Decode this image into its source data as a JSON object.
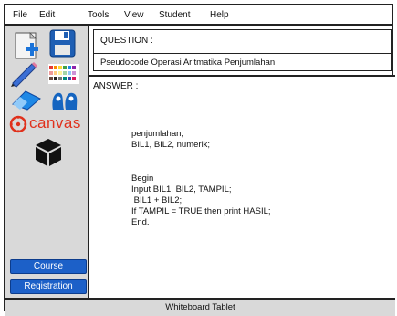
{
  "menu": {
    "items": [
      "File",
      "Edit",
      "Tools",
      "View",
      "Student",
      "Help"
    ]
  },
  "sidebar": {
    "tools": [
      "new-document-icon",
      "save-icon",
      "pencil-icon",
      "color-palette-icon",
      "eraser-icon",
      "blob-icon",
      "canvas-logo",
      "cube-icon"
    ],
    "canvas_logo_text": "canvas",
    "buttons": [
      "Course",
      "Registration"
    ]
  },
  "question": {
    "label": "QUESTION :",
    "text": "Pseudocode Operasi Aritmatika Penjumlahan"
  },
  "answer": {
    "label": "ANSWER :",
    "lines": [
      "penjumlahan,",
      "BIL1, BIL2, numerik;",
      "",
      "",
      "Begin",
      "Input BIL1, BIL2, TAMPIL;",
      " BIL1 + BIL2;",
      "If TAMPIL = TRUE then print HASIL;",
      "End."
    ]
  },
  "status": {
    "text": "Whiteboard Tablet"
  },
  "colors": {
    "button_blue": "#1c60c8",
    "canvas_red": "#e0311c",
    "icon_blue": "#1a73d9",
    "panel_gray": "#d9d9d9"
  }
}
